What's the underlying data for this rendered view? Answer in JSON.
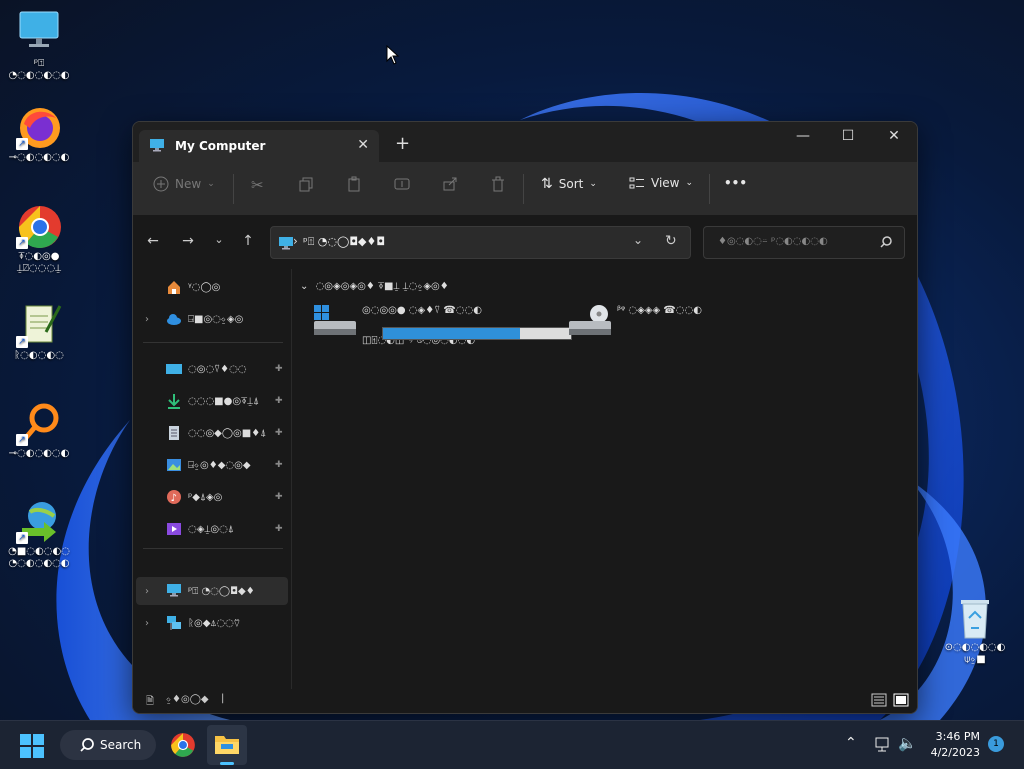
{
  "desktop": {
    "icons": [
      {
        "name": "this-pc",
        "label": "ᵖ⍐ ◔◌◐◌◐◌◐",
        "icon": "monitor-icon"
      },
      {
        "name": "firefox",
        "label": "⊸◌◐◌◐◌◐",
        "icon": "firefox-icon"
      },
      {
        "name": "chrome",
        "label": "⍕◌◐◎● ⍊⍁◌◌◌⍊",
        "icon": "chrome-icon"
      },
      {
        "name": "notepad",
        "label": "ᚱ◌◐◌◐◌",
        "icon": "notepad-icon"
      },
      {
        "name": "search-app",
        "label": "⊸◌◐◌◐◌◐",
        "icon": "magnifier-icon"
      },
      {
        "name": "download-manager",
        "label": "◔■◌◐◌◐◌ ◔◌◐◌◐◌◐",
        "icon": "globe-arrow-icon"
      }
    ],
    "recycle_bin": {
      "label": "⊙◌◐◌◐◌◐ ⍦⍚■",
      "icon": "recycle-bin-icon"
    }
  },
  "window": {
    "tab_title": "My Computer",
    "close_tab": "✕",
    "new_tab": "+",
    "controls": {
      "minimize": "—",
      "maximize": "☐",
      "close": "✕"
    },
    "toolbar": {
      "new_label": "New",
      "sort_label": "Sort",
      "view_label": "View",
      "more_label": "•••"
    },
    "address": {
      "separator": "›",
      "path": "ᵖ⍐ ◔◌◯◘◆♦◘",
      "dropdown": "⌄",
      "refresh": "↻"
    },
    "search": {
      "placeholder": "♦◎◌◐◌⍨ ᵖ◌◐◌◐◌◐"
    },
    "sidebar": {
      "items": [
        {
          "label": "ᵞ◌◯◎",
          "icon": "home-icon"
        },
        {
          "label": "⍈■◎◌⍚◈◎",
          "icon": "cloud-icon",
          "arrow": "›"
        },
        {
          "label": "◌◎◌⍢♦◌◌",
          "icon": "desktop-folder-icon",
          "pin": "📌"
        },
        {
          "label": "◌◌◌■●◎⍕⍊⍋",
          "icon": "download-icon",
          "pin": "📌"
        },
        {
          "label": "◌◌◎◆◯◎■♦⍋",
          "icon": "document-icon",
          "pin": "📌"
        },
        {
          "label": "⍈⍚◎♦◆◌◎◆",
          "icon": "pictures-icon",
          "pin": "📌"
        },
        {
          "label": "ᵖ◆⍋◈◎",
          "icon": "music-icon",
          "pin": "📌"
        },
        {
          "label": "◌◈⍊◎◌⍋",
          "icon": "videos-icon",
          "pin": "📌"
        },
        {
          "label": "ᵖ⍐ ◔◌◯◘◆♦",
          "icon": "this-pc-icon",
          "arrow": "›"
        },
        {
          "label": "ᚱ◎◆⍋◌◌⍢",
          "icon": "network-icon",
          "arrow": "›"
        }
      ]
    },
    "content": {
      "group_label": "◌◎◈◎◈◎♦ ⍕■⍊ ⍊◌⍚◈◎♦",
      "group_chevron": "⌄",
      "drives": [
        {
          "name": "◎◌◎◎● ◌◈♦⍢ ☎◌◌◐",
          "free": "◫⍐◌◐◫ ᛃ ⍉◌◎◌◐◌◐",
          "used_fraction": 0.73,
          "icon": "windows-drive-icon"
        },
        {
          "name": "ᵝᵠ ◌◈◈◈ ☎◌◌◐",
          "icon": "dvd-drive-icon"
        }
      ]
    },
    "status": {
      "label": "⍚♦◎◯◆",
      "cursor_mark": "|"
    }
  },
  "taskbar": {
    "search_label": "Search",
    "time": "3:46 PM",
    "date": "4/2/2023",
    "notification_count": "1",
    "tray_up": "⌃"
  }
}
